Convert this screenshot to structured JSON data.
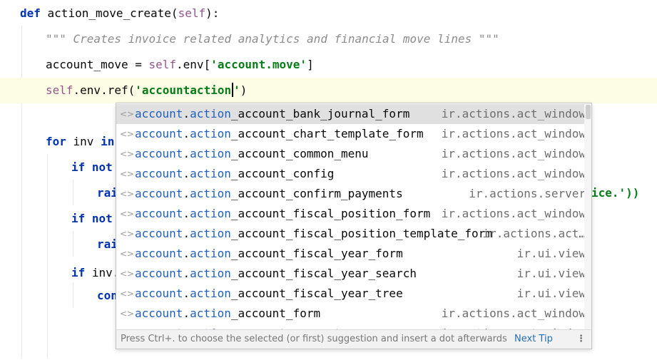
{
  "editor": {
    "lines": [
      {
        "def_kw": "def",
        "fn": " action_move_create(",
        "self": "self",
        "close": "):"
      },
      {
        "doc": "\"\"\" Creates invoice related analytics and financial move lines \"\"\""
      },
      {
        "var": "account_move = ",
        "self": "self",
        "mid": ".env[",
        "str": "'account.move'",
        "end": "]"
      },
      {
        "self": "self",
        "mid": ".env.ref(",
        "str_a": "'accountaction",
        "str_b": "'",
        "end": ")"
      },
      {
        "for_kw": "for",
        "rest": " inv ",
        "in_kw": "in"
      },
      {
        "kw": "if not"
      },
      {
        "rai": "rai",
        "tail": "ice.'))"
      },
      {
        "kw": "if not"
      },
      {
        "rai": "rai"
      },
      {
        "kw": "if",
        "rest": " inv."
      },
      {
        "con": "con"
      }
    ]
  },
  "autocomplete": {
    "match_prefix": "account",
    "match_dot": ".",
    "match_action": "action",
    "items": [
      {
        "rest": "_account_bank_journal_form",
        "type": "ir.actions.act_window"
      },
      {
        "rest": "_account_chart_template_form",
        "type": "ir.actions.act_window"
      },
      {
        "rest": "_account_common_menu",
        "type": "ir.actions.act_window"
      },
      {
        "rest": "_account_config",
        "type": "ir.actions.act_window"
      },
      {
        "rest": "_account_confirm_payments",
        "type": "ir.actions.server"
      },
      {
        "rest": "_account_fiscal_position_form",
        "type": "ir.actions.act_window"
      },
      {
        "rest": "_account_fiscal_position_template_form",
        "type": "ir.actions.act…"
      },
      {
        "rest": "_account_fiscal_year_form",
        "type": "ir.ui.view"
      },
      {
        "rest": "_account_fiscal_year_search",
        "type": "ir.ui.view"
      },
      {
        "rest": "_account_fiscal_year_tree",
        "type": "ir.ui.view"
      },
      {
        "rest": "_account_form",
        "type": "ir.actions.act_window"
      },
      {
        "rest": "_account_group_tree",
        "type": "ir.actions.act_window"
      }
    ],
    "item_icon": "<>",
    "footer_hint": "Press Ctrl+. to choose the selected (or first) suggestion and insert a dot afterwards",
    "next_tip": "Next Tip",
    "menu_glyph": "⋮"
  },
  "colors": {
    "keyword": "#0033b3",
    "self": "#94558d",
    "string": "#067d17",
    "match_highlight": "#1f5fbf",
    "current_line": "#fdfce4",
    "selected_item": "#e0e0e0"
  }
}
